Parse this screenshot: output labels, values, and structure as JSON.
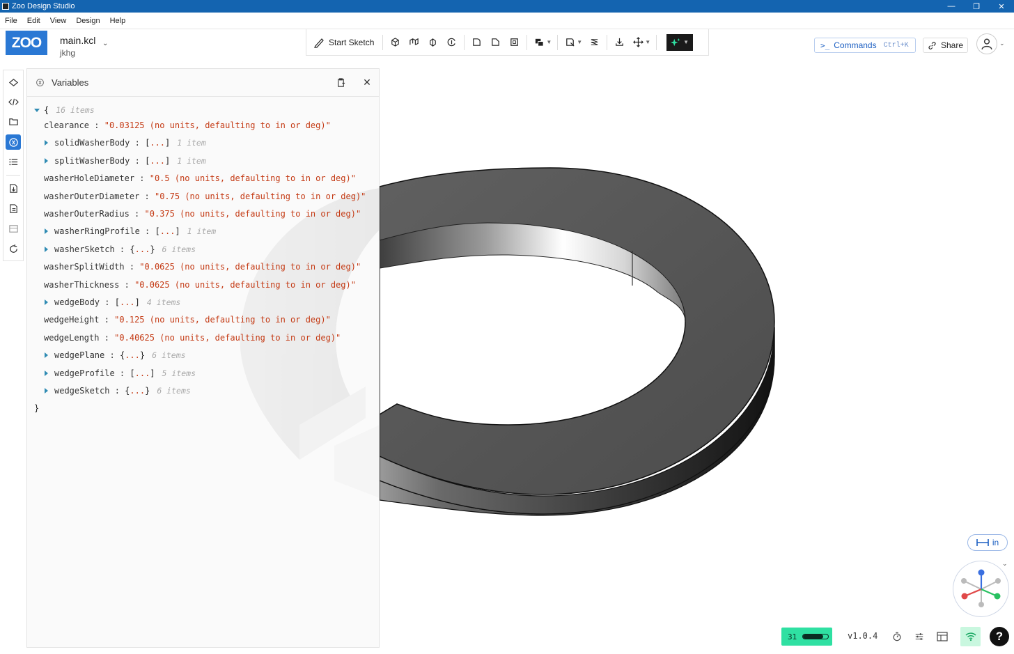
{
  "window": {
    "title": "Zoo Design Studio",
    "min": "—",
    "restore": "❐",
    "close": "✕"
  },
  "menu": [
    "File",
    "Edit",
    "View",
    "Design",
    "Help"
  ],
  "header": {
    "logo": "ZOO",
    "file_name": "main.kcl",
    "project_name": "jkhg",
    "start_sketch": "Start Sketch",
    "commands_label": "Commands",
    "commands_shortcut": "Ctrl+K",
    "share_label": "Share"
  },
  "variables_pane": {
    "title": "Variables",
    "root_open": "{",
    "root_count": "16 items",
    "root_close": "}",
    "rows": [
      {
        "key": "clearance",
        "type": "string",
        "value": "\"0.03125 (no units, defaulting to in or deg)\""
      },
      {
        "key": "solidWasherBody",
        "type": "array",
        "value": "[...]",
        "count": "1 item"
      },
      {
        "key": "splitWasherBody",
        "type": "array",
        "value": "[...]",
        "count": "1 item"
      },
      {
        "key": "washerHoleDiameter",
        "type": "string",
        "value": "\"0.5 (no units, defaulting to in or deg)\""
      },
      {
        "key": "washerOuterDiameter",
        "type": "string",
        "value": "\"0.75 (no units, defaulting to in or deg)\""
      },
      {
        "key": "washerOuterRadius",
        "type": "string",
        "value": "\"0.375 (no units, defaulting to in or deg)\""
      },
      {
        "key": "washerRingProfile",
        "type": "array",
        "value": "[...]",
        "count": "1 item"
      },
      {
        "key": "washerSketch",
        "type": "object",
        "value": "{...}",
        "count": "6 items"
      },
      {
        "key": "washerSplitWidth",
        "type": "string",
        "value": "\"0.0625 (no units, defaulting to in or deg)\""
      },
      {
        "key": "washerThickness",
        "type": "string",
        "value": "\"0.0625 (no units, defaulting to in or deg)\""
      },
      {
        "key": "wedgeBody",
        "type": "array",
        "value": "[...]",
        "count": "4 items"
      },
      {
        "key": "wedgeHeight",
        "type": "string",
        "value": "\"0.125 (no units, defaulting to in or deg)\""
      },
      {
        "key": "wedgeLength",
        "type": "string",
        "value": "\"0.40625 (no units, defaulting to in or deg)\""
      },
      {
        "key": "wedgePlane",
        "type": "object",
        "value": "{...}",
        "count": "6 items"
      },
      {
        "key": "wedgeProfile",
        "type": "array",
        "value": "[...]",
        "count": "5 items"
      },
      {
        "key": "wedgeSketch",
        "type": "object",
        "value": "{...}",
        "count": "6 items"
      }
    ]
  },
  "viewport": {
    "units_label": "in"
  },
  "status": {
    "network_count": "31",
    "network_level": 0.8,
    "version": "v1.0.4",
    "help": "?"
  },
  "colors": {
    "titlebar": "#1464b0",
    "brand": "#2a78d4",
    "string_value": "#c43a14",
    "network_ok": "#2fe0a2"
  }
}
